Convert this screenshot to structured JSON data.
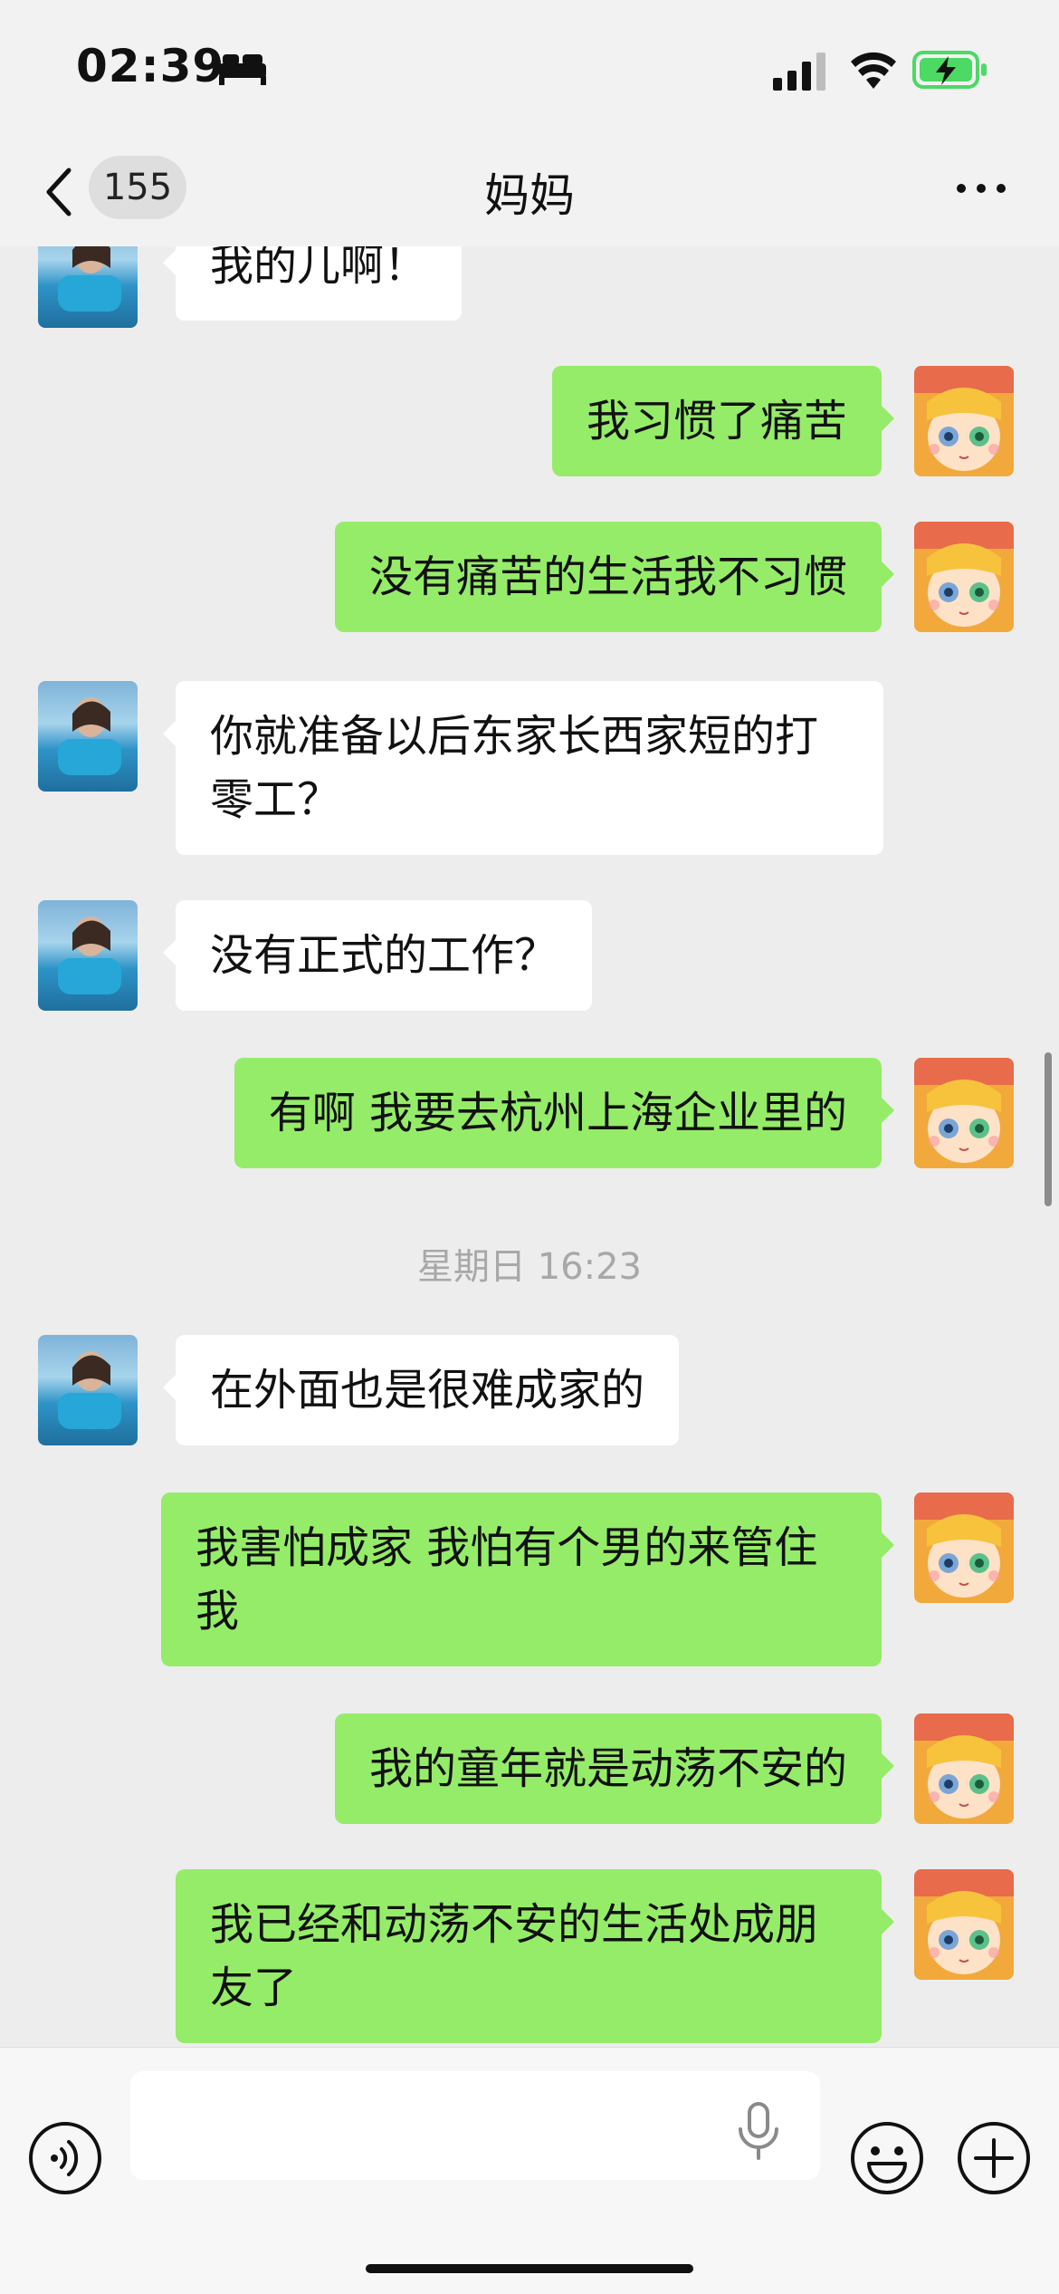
{
  "status_bar": {
    "time": "02:39"
  },
  "nav": {
    "unread_count": "155",
    "title": "妈妈"
  },
  "messages": [
    {
      "sender": "mom",
      "text": "我的儿啊！"
    },
    {
      "sender": "me",
      "text": "我习惯了痛苦"
    },
    {
      "sender": "me",
      "text": "没有痛苦的生活我不习惯"
    },
    {
      "sender": "mom",
      "text": "你就准备以后东家长西家短的打零工？"
    },
    {
      "sender": "mom",
      "text": "没有正式的工作？"
    },
    {
      "sender": "me",
      "text": "有啊 我要去杭州上海企业里的"
    },
    {
      "sender": "mom",
      "text": "在外面也是很难成家的"
    },
    {
      "sender": "me",
      "text": "我害怕成家 我怕有个男的来管住我"
    },
    {
      "sender": "me",
      "text": "我的童年就是动荡不安的"
    },
    {
      "sender": "me",
      "text": "我已经和动荡不安的生活处成朋友了"
    }
  ],
  "timestamp": "星期日 16:23",
  "input": {
    "value": "",
    "placeholder": ""
  },
  "icons": {
    "voice": "voice-icon",
    "emoji": "emoji-icon",
    "plus": "plus-icon",
    "mic": "microphone-icon",
    "back": "chevron-left-icon",
    "more": "more-dots-icon",
    "signal": "signal-icon",
    "wifi": "wifi-icon",
    "battery": "battery-charging-icon",
    "sleep": "bed-icon"
  },
  "colors": {
    "outgoing_bubble": "#95ec69",
    "incoming_bubble": "#ffffff",
    "background": "#ededed",
    "battery": "#4cd964"
  }
}
